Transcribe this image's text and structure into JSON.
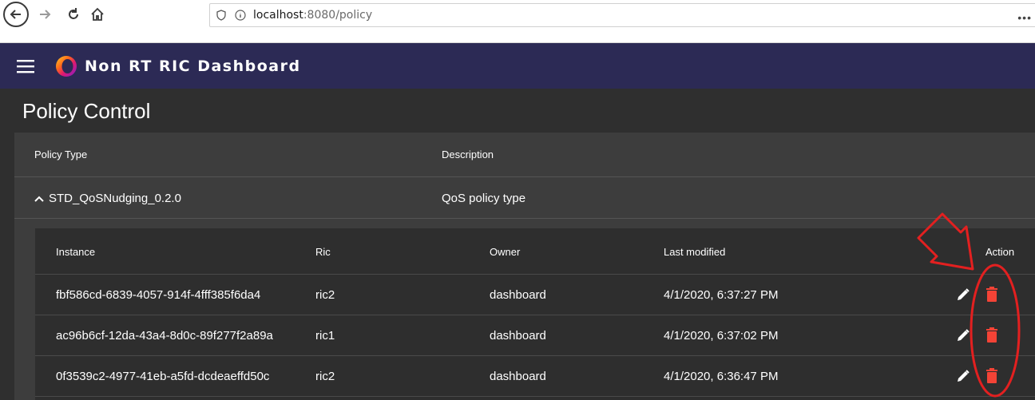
{
  "browser": {
    "url_host": "localhost",
    "url_rest": ":8080/policy"
  },
  "app": {
    "title": "Non RT RIC Dashboard"
  },
  "page": {
    "title": "Policy Control"
  },
  "types_table": {
    "headers": {
      "policy_type": "Policy Type",
      "description": "Description"
    },
    "rows": [
      {
        "name": "STD_QoSNudging_0.2.0",
        "description": "QoS policy type"
      }
    ]
  },
  "instances_table": {
    "headers": {
      "instance": "Instance",
      "ric": "Ric",
      "owner": "Owner",
      "last_modified": "Last modified",
      "action": "Action"
    },
    "rows": [
      {
        "instance": "fbf586cd-6839-4057-914f-4fff385f6da4",
        "ric": "ric2",
        "owner": "dashboard",
        "last_modified": "4/1/2020, 6:37:27 PM"
      },
      {
        "instance": "ac96b6cf-12da-43a4-8d0c-89f277f2a89a",
        "ric": "ric1",
        "owner": "dashboard",
        "last_modified": "4/1/2020, 6:37:02 PM"
      },
      {
        "instance": "0f3539c2-4977-41eb-a5fd-dcdeaeffd50c",
        "ric": "ric2",
        "owner": "dashboard",
        "last_modified": "4/1/2020, 6:36:47 PM"
      }
    ]
  },
  "colors": {
    "header_bg": "#2c2a55",
    "delete": "#f44336",
    "annotation": "#e32020"
  }
}
